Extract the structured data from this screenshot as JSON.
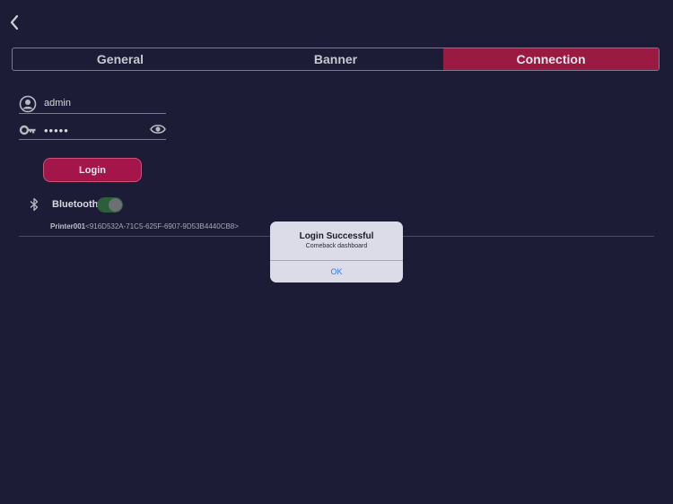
{
  "tabs": [
    {
      "label": "General"
    },
    {
      "label": "Banner"
    },
    {
      "label": "Connection"
    }
  ],
  "login": {
    "username_value": "admin",
    "password_value": "•••••",
    "button_label": "Login"
  },
  "bluetooth": {
    "label": "Bluetooth",
    "enabled": true
  },
  "device": {
    "name": "Printer001",
    "id": "<916D532A-71C5-625F-6907-9D53B4440CB8>"
  },
  "alert": {
    "title": "Login Successful",
    "message": "Comeback dashboard",
    "ok_label": "OK"
  },
  "colors": {
    "background": "#1c1c36",
    "accent": "#9a1a42",
    "link": "#2d7bf0"
  }
}
